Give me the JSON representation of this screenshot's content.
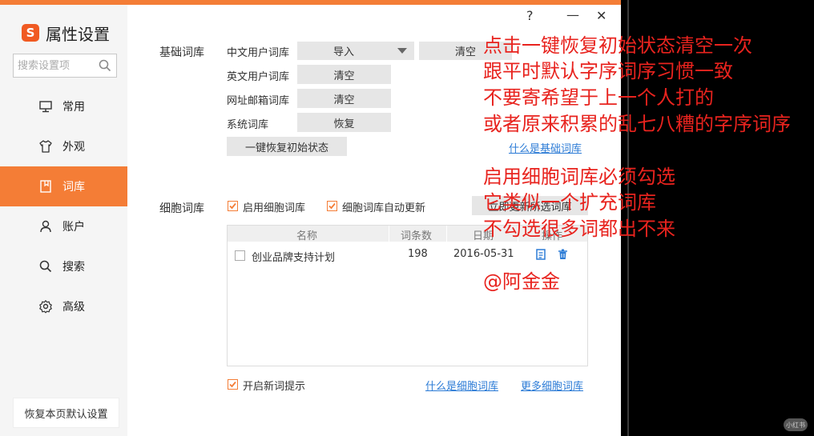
{
  "window": {
    "title": "属性设置",
    "help": "?",
    "minimize": "—",
    "close": "✕"
  },
  "search": {
    "placeholder": "搜索设置项"
  },
  "nav": {
    "items": [
      {
        "label": "常用",
        "icon": "monitor-icon"
      },
      {
        "label": "外观",
        "icon": "shirt-icon"
      },
      {
        "label": "词库",
        "icon": "book-icon",
        "active": true
      },
      {
        "label": "账户",
        "icon": "user-icon"
      },
      {
        "label": "搜索",
        "icon": "search-icon"
      },
      {
        "label": "高级",
        "icon": "gear-icon"
      }
    ]
  },
  "restore_page_label": "恢复本页默认设置",
  "basic": {
    "section_label": "基础词库",
    "rows": [
      {
        "label": "中文用户词库",
        "btn1": "导入",
        "btn2": "清空"
      },
      {
        "label": "英文用户词库",
        "btn1": "清空"
      },
      {
        "label": "网址邮箱词库",
        "btn1": "清空"
      },
      {
        "label": "系统词库",
        "btn1": "恢复"
      }
    ],
    "restore_initial": "一键恢复初始状态",
    "what_is_link": "什么是基础词库"
  },
  "cell": {
    "section_label": "细胞词库",
    "enable_label": "启用细胞词库",
    "enable_checked": true,
    "auto_update_label": "细胞词库自动更新",
    "auto_update_checked": true,
    "update_now_btn": "立即更新所选词库",
    "table": {
      "headers": [
        "名称",
        "词条数",
        "日期",
        "操作"
      ],
      "rows": [
        {
          "name": "创业品牌支持计划",
          "count": "198",
          "date": "2016-05-31",
          "checked": false
        }
      ]
    },
    "new_word_tip_label": "开启新词提示",
    "new_word_tip_checked": true,
    "what_is_link": "什么是细胞词库",
    "more_link": "更多细胞词库"
  },
  "annotations": [
    "点击一键恢复初始状态清空一次",
    "跟平时默认字序词序习惯一致",
    "不要寄希望于上一个人打的",
    "或者原来积累的乱七八糟的字序词序",
    "启用细胞词库必须勾选",
    "它类似一个扩充词库",
    "不勾选很多词都出不来",
    "@阿金金"
  ],
  "watermark": "小红书",
  "colors": {
    "accent": "#f47d36",
    "link": "#2b7bd6",
    "annotation": "#e8231e"
  }
}
